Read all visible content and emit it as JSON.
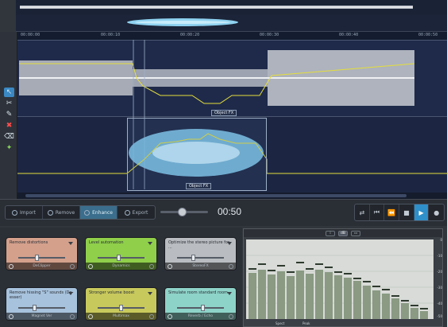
{
  "editor": {
    "ruler_marks": [
      "00:00:00",
      "00:00:10",
      "00:00:20",
      "00:00:30",
      "00:00:40",
      "00:00:50"
    ],
    "object_label_1": "Object FX",
    "object_label_2": "Object FX"
  },
  "tools": [
    "select-icon",
    "cut-icon",
    "pencil-icon",
    "delete-icon",
    "erase-icon",
    "wand-icon"
  ],
  "mode_tabs": [
    {
      "label": "Import",
      "active": false
    },
    {
      "label": "Remove",
      "active": false
    },
    {
      "label": "Enhance",
      "active": true
    },
    {
      "label": "Export",
      "active": false
    }
  ],
  "volume_level": 0.45,
  "timecode": "00:50",
  "playback": [
    "loop-icon",
    "to-start-icon",
    "rewind-icon",
    "stop-icon",
    "play-icon",
    "record-icon"
  ],
  "effects": [
    {
      "name": "Remove distortions",
      "preset": "DeClipper",
      "color": "orange",
      "level": 0.35
    },
    {
      "name": "Level automation",
      "preset": "Dynamics",
      "color": "green",
      "level": 0.4
    },
    {
      "name": "Optimize the stereo picture for ...",
      "preset": "StereoFX",
      "color": "gray",
      "level": 0.3
    },
    {
      "name": "Remove hissing \"S\" sounds (De-esser)",
      "preset": "Magnet Ver",
      "color": "blue",
      "level": 0.3
    },
    {
      "name": "Stronger volume boost",
      "preset": "Multimax",
      "color": "yellow",
      "level": 0.45
    },
    {
      "name": "Simulate room standard room",
      "preset": "Reverb / Echo",
      "color": "teal",
      "level": 0.5
    }
  ],
  "analyzer": {
    "header_buttons": [
      "i",
      "dB",
      "▭"
    ],
    "scale": [
      "0",
      "-10",
      "-20",
      "-30",
      "-40",
      "-50"
    ],
    "footer": [
      "Spect",
      "Peak"
    ]
  }
}
